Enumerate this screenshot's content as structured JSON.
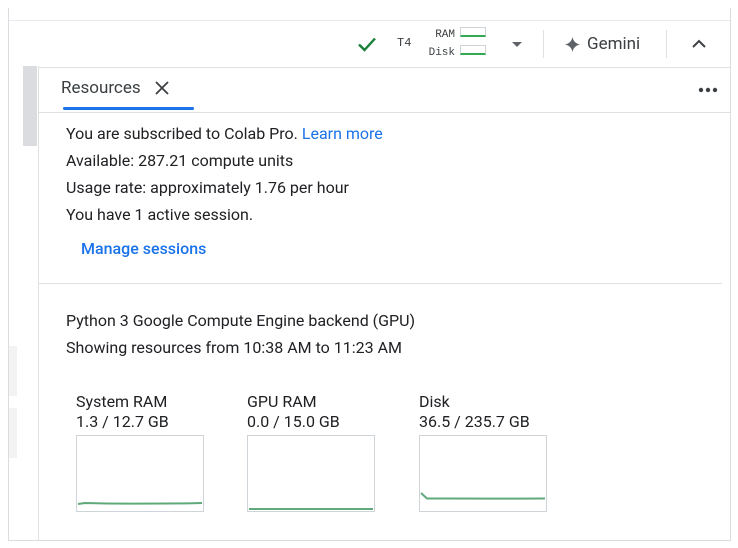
{
  "header": {
    "accelerator": "T4",
    "ram_label": "RAM",
    "disk_label": "Disk",
    "gemini_label": "Gemini"
  },
  "tab": {
    "label": "Resources"
  },
  "subscription": {
    "text": "You are subscribed to Colab Pro.",
    "link": "Learn more"
  },
  "available": "Available: 287.21 compute units",
  "usage_rate": "Usage rate: approximately 1.76 per hour",
  "sessions": "You have 1 active session.",
  "manage_sessions": "Manage sessions",
  "backend": "Python 3 Google Compute Engine backend (GPU)",
  "time_range": "Showing resources from 10:38 AM to 11:23 AM",
  "gauges": [
    {
      "title": "System RAM",
      "value": "1.3 / 12.7 GB",
      "fraction": 0.102
    },
    {
      "title": "GPU RAM",
      "value": "0.0 / 15.0 GB",
      "fraction": 0.0
    },
    {
      "title": "Disk",
      "value": "36.5 / 235.7 GB",
      "fraction": 0.155
    }
  ],
  "colors": {
    "accent": "#1a73e8",
    "check": "#188038",
    "chart_line": "#34a853"
  }
}
